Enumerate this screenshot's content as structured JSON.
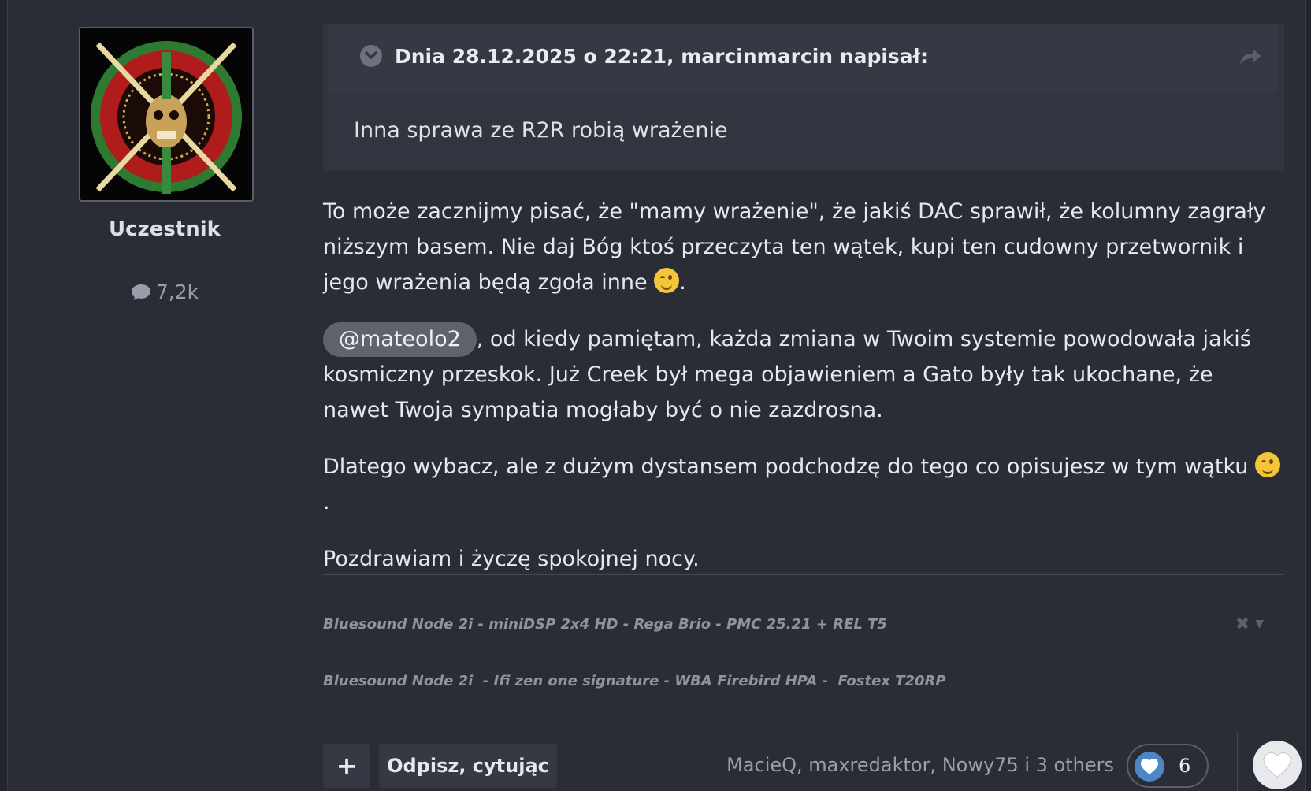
{
  "author": {
    "rank": "Uczestnik",
    "post_count": "7,2k",
    "avatar_icon": "skull-crossed-swords-emblem"
  },
  "quote": {
    "citation": "Dnia 28.12.2025 o 22:21, marcinmarcin napisał:",
    "text": "Inna sprawa ze R2R robią wrażenie"
  },
  "post": {
    "p1": "To może zacznijmy pisać, że \"mamy wrażenie\", że jakiś DAC sprawił, że kolumny zagrały niższym basem. Nie daj Bóg ktoś przeczyta ten wątek, kupi ten cudowny przetwornik i jego wrażenia będą zgoła inne",
    "p1_end": ".",
    "mention": "@mateolo2",
    "p2": ", od kiedy pamiętam, każda zmiana w Twoim systemie powodowała jakiś kosmiczny przeskok. Już Creek był mega objawieniem a Gato były tak ukochane, że nawet Twoja sympatia mogłaby być o nie zazdrosna.",
    "p3": "Dlatego wybacz, ale z dużym dystansem podchodzę do tego co opisujesz w tym wątku",
    "p3_end": ".",
    "p4": "Pozdrawiam i życzę spokojnej nocy."
  },
  "signature": {
    "line1": "Bluesound Node 2i - miniDSP 2x4 HD - Rega Brio - PMC 25.21 + REL T5",
    "line2": "Bluesound Node 2i  - Ifi zen one signature - WBA Firebird HPA -  Fostex T20RP"
  },
  "actions": {
    "plus_label": "+",
    "quote_reply_label": "Odpisz, cytując",
    "reactions_text": "MacieQ, maxredaktor, Nowy75 i 3 others",
    "reaction_count": "6"
  },
  "colors": {
    "background": "#2b2d36",
    "quote_bg": "#32353f",
    "mention_bg": "#5f636e",
    "reaction_blue": "#4d86c4"
  }
}
